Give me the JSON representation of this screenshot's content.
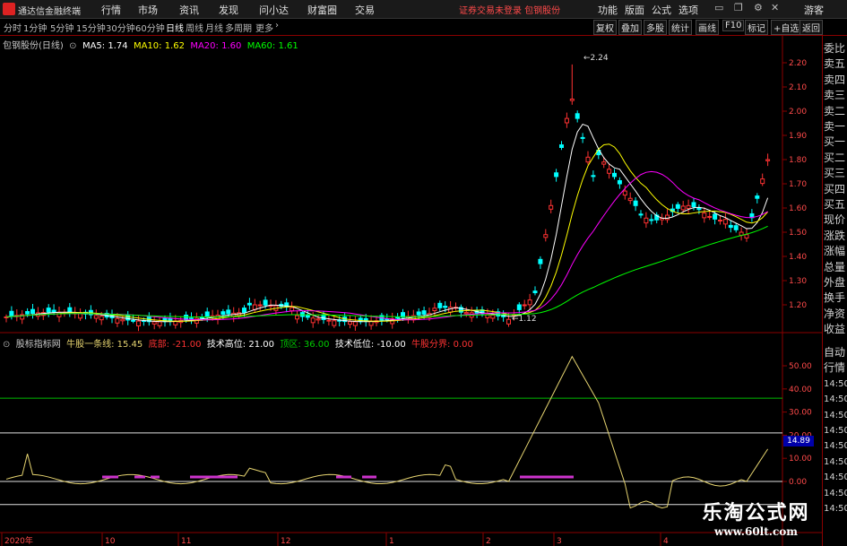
{
  "titlebar": {
    "app_name": "通达信金融终端",
    "menus": [
      "行情",
      "市场",
      "资讯",
      "发现",
      "问小达",
      "财富圈",
      "交易"
    ],
    "notice": "证券交易未登录  包钢股份",
    "right_menus": [
      "功能",
      "版面",
      "公式",
      "选项"
    ],
    "guest": "游客"
  },
  "toolbar": {
    "timeframes": [
      "分时",
      "1分钟",
      "5分钟",
      "15分钟",
      "30分钟",
      "60分钟",
      "日线",
      "周线",
      "月线",
      "多周期",
      "更多"
    ],
    "active_index": 6,
    "right_buttons": [
      "复权",
      "叠加",
      "多股",
      "统计",
      "画线",
      "F10",
      "标记",
      "+自选",
      "返回"
    ]
  },
  "main_legend": {
    "title": "包钢股份(日线)",
    "ma": [
      {
        "label": "MA5: 1.74",
        "color": "#ffffff"
      },
      {
        "label": "MA10: 1.62",
        "color": "#ffff00"
      },
      {
        "label": "MA20: 1.60",
        "color": "#ff00ff"
      },
      {
        "label": "MA60: 1.61",
        "color": "#00ff00"
      }
    ]
  },
  "sub_legend": {
    "title": "股标指标网",
    "items": [
      {
        "label": "牛股一条线: 15.45",
        "color": "#e6d470"
      },
      {
        "label": "底部: -21.00",
        "color": "#ff3333"
      },
      {
        "label": "技术高位: 21.00",
        "color": "#ffffff"
      },
      {
        "label": "顶区: 36.00",
        "color": "#00cc00"
      },
      {
        "label": "技术低位: -10.00",
        "color": "#ffffff"
      },
      {
        "label": "牛股分界: 0.00",
        "color": "#ff3333"
      }
    ]
  },
  "price_axis": [
    "2.20",
    "2.10",
    "2.00",
    "1.90",
    "1.80",
    "1.70",
    "1.60",
    "1.50",
    "1.40",
    "1.30",
    "1.20"
  ],
  "indicator_axis": [
    "50.00",
    "40.00",
    "30.00",
    "20.00",
    "10.00",
    "0.00"
  ],
  "indicator_current": "14.89",
  "annotations": {
    "high": "2.24",
    "low": "1.12"
  },
  "date_axis": [
    "2020年",
    "10",
    "11",
    "12",
    "1",
    "2",
    "3",
    "4"
  ],
  "quote_column": [
    "委比",
    "卖五",
    "卖四",
    "卖三",
    "卖二",
    "卖一",
    "买一",
    "买二",
    "买三",
    "买四",
    "买五",
    "现价",
    "涨跌",
    "涨幅",
    "总量",
    "外盘",
    "换手",
    "净资",
    "收益"
  ],
  "quote_column_lower": [
    "自动",
    "行情",
    "14:50",
    "14:50",
    "14:50",
    "14:50",
    "14:50",
    "14:50",
    "14:50",
    "14:50",
    "14:50"
  ],
  "watermark": {
    "line1": "乐淘公式网",
    "line2": "www.60lt.com"
  },
  "colors": {
    "up": "#ff3232",
    "down": "#00ffff",
    "frame": "#8b0000"
  }
}
